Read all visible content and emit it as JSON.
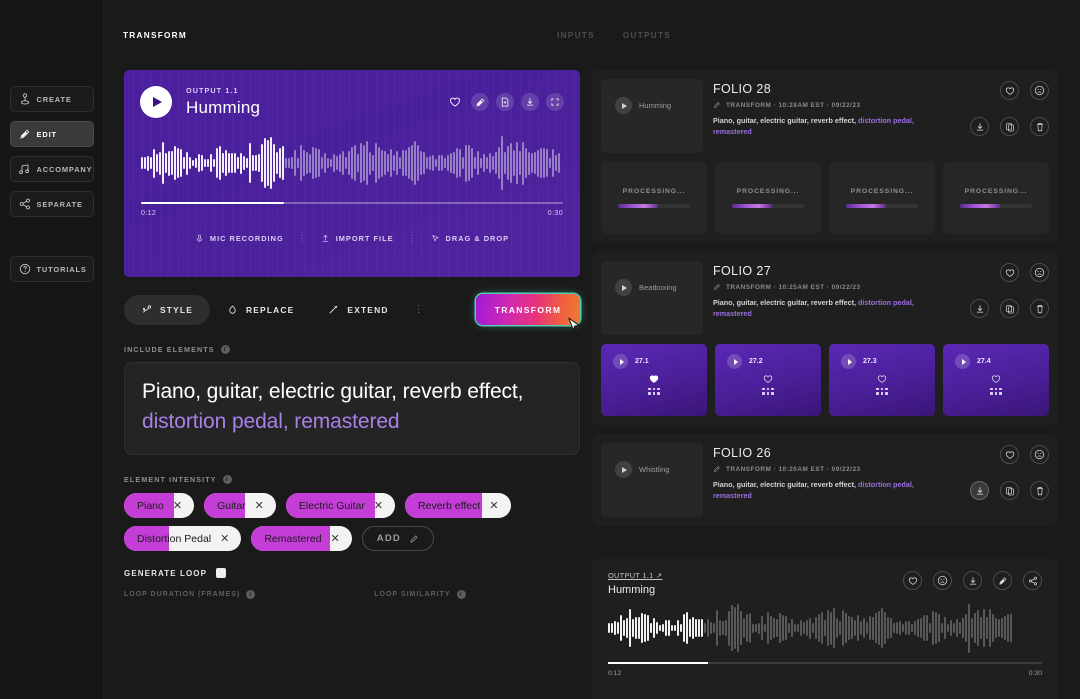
{
  "sidebar": {
    "items": [
      {
        "label": "CREATE",
        "icon": "create-icon",
        "active": false
      },
      {
        "label": "EDIT",
        "icon": "edit-pen-icon",
        "active": true
      },
      {
        "label": "ACCOMPANY",
        "icon": "accompany-icon",
        "active": false
      },
      {
        "label": "SEPARATE",
        "icon": "separate-share-icon",
        "active": false
      }
    ],
    "tutorials": {
      "label": "TUTORIALS",
      "icon": "question-circle-icon"
    }
  },
  "topnav": {
    "items": [
      {
        "label": "TRANSFORM",
        "active": true
      },
      {
        "label": "INPUTS",
        "active": false
      },
      {
        "label": "OUTPUTS",
        "active": false
      }
    ]
  },
  "player": {
    "kicker": "OUTPUT 1.1",
    "title": "Humming",
    "time_current": "0:12",
    "time_total": "0:30",
    "progress_percent": 34,
    "actions": [
      {
        "name": "favorite-icon",
        "style": "plain"
      },
      {
        "name": "edit-icon",
        "style": "round"
      },
      {
        "name": "file-icon",
        "style": "round"
      },
      {
        "name": "download-icon",
        "style": "round"
      },
      {
        "name": "expand-icon",
        "style": "round"
      }
    ],
    "sources": [
      {
        "label": "MIC RECORDING",
        "icon": "microphone-icon"
      },
      {
        "label": "IMPORT FILE",
        "icon": "upload-icon"
      },
      {
        "label": "DRAG & DROP",
        "icon": "cursor-arrow-icon"
      }
    ]
  },
  "actions": {
    "style_label": "STYLE",
    "replace_label": "REPLACE",
    "extend_label": "EXTEND",
    "transform_label": "TRANSFORM"
  },
  "include_elements": {
    "label": "INCLUDE ELEMENTS",
    "text_plain": "Piano, guitar, electric guitar, reverb effect, ",
    "text_highlight": "distortion pedal, remastered"
  },
  "element_intensity": {
    "label": "ELEMENT INTENSITY",
    "add_label": "ADD",
    "tags": [
      {
        "label": "Piano",
        "intensity": 72
      },
      {
        "label": "Guitar",
        "intensity": 57
      },
      {
        "label": "Electric Guitar",
        "intensity": 82
      },
      {
        "label": "Reverb effect",
        "intensity": 73
      },
      {
        "label": "Distortion Pedal",
        "intensity": 38
      },
      {
        "label": "Remastered",
        "intensity": 78
      }
    ]
  },
  "loop": {
    "generate_label": "GENERATE LOOP",
    "duration_label": "LOOP DURATION (FRAMES)",
    "similarity_label": "LOOP SIMILARITY"
  },
  "folios": [
    {
      "title": "FOLIO 28",
      "thumb_label": "Humming",
      "meta": "TRANSFORM · 10:28AM EST · 09/22/23",
      "desc_plain": "Piano, guitar, electric guitar, reverb effect, ",
      "desc_highlight": "distortion pedal, remastered",
      "download_active": false,
      "children_type": "processing",
      "children": [
        {
          "label": "PROCESSING...",
          "progress": 55
        },
        {
          "label": "PROCESSING...",
          "progress": 55
        },
        {
          "label": "PROCESSING...",
          "progress": 55
        },
        {
          "label": "PROCESSING...",
          "progress": 55
        }
      ]
    },
    {
      "title": "FOLIO 27",
      "thumb_label": "Beatboxing",
      "meta": "TRANSFORM · 10:25AM EST · 09/22/23",
      "desc_plain": "Piano, guitar, electric guitar, reverb effect, ",
      "desc_highlight": "distortion pedal, remastered",
      "download_active": false,
      "children_type": "result",
      "children": [
        {
          "label": "27.1",
          "favorited": true
        },
        {
          "label": "27.2",
          "favorited": false
        },
        {
          "label": "27.3",
          "favorited": false
        },
        {
          "label": "27.4",
          "favorited": false
        }
      ]
    },
    {
      "title": "FOLIO 26",
      "thumb_label": "Whistling",
      "meta": "TRANSFORM · 10:20AM EST · 09/22/23",
      "desc_plain": "Piano, guitar, electric guitar, reverb effect, ",
      "desc_highlight": "distortion pedal, remastered",
      "download_active": true,
      "children_type": "none",
      "children": []
    }
  ],
  "bottom_player": {
    "kicker": "OUTPUT 1.1",
    "title": "Humming",
    "time_current": "0:12",
    "time_total": "0:30",
    "progress_percent": 23,
    "actions": [
      {
        "name": "favorite-icon"
      },
      {
        "name": "dislike-face-icon"
      },
      {
        "name": "download-icon"
      },
      {
        "name": "edit-icon"
      },
      {
        "name": "share-icon"
      }
    ]
  },
  "colors": {
    "accent_purple": "#5b28b5",
    "tag_fill": "#c33dd6",
    "highlight_text": "#a880e8",
    "background": "#1a1a1a"
  }
}
